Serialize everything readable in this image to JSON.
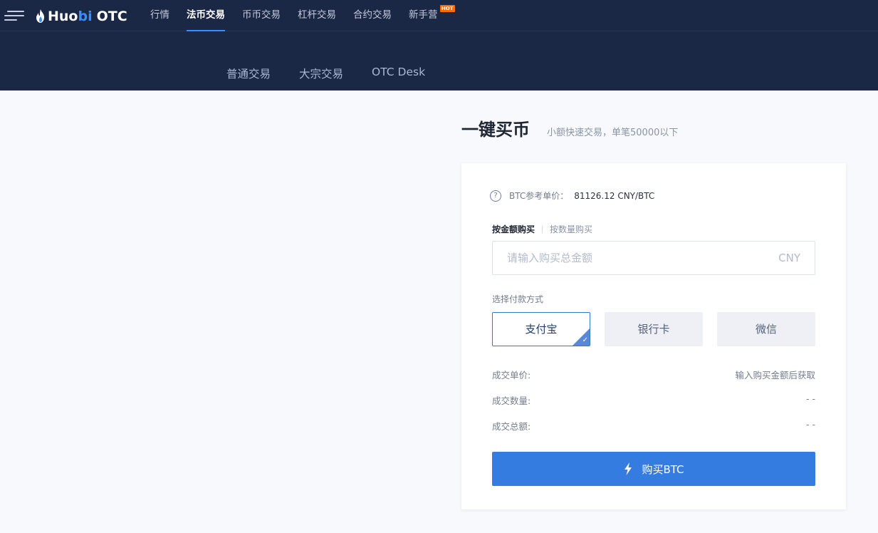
{
  "header": {
    "logo": {
      "brand_a": "Huo",
      "brand_b": "bi",
      "brand_c": "OTC"
    },
    "nav": [
      {
        "label": "行情",
        "active": false
      },
      {
        "label": "法币交易",
        "active": true
      },
      {
        "label": "币币交易",
        "active": false
      },
      {
        "label": "杠杆交易",
        "active": false
      },
      {
        "label": "合约交易",
        "active": false
      },
      {
        "label": "新手营",
        "active": false,
        "badge": "HOT"
      }
    ]
  },
  "subnav": [
    {
      "label": "普通交易"
    },
    {
      "label": "大宗交易"
    },
    {
      "label": "OTC Desk"
    }
  ],
  "page": {
    "title": "一键买币",
    "subtitle": "小额快速交易，单笔50000以下"
  },
  "card": {
    "ref_label": "BTC参考单价：",
    "ref_value": "81126.12 CNY/BTC",
    "modes": [
      {
        "label": "按金额购买",
        "active": true
      },
      {
        "label": "按数量购买",
        "active": false
      }
    ],
    "amount_input": {
      "placeholder": "请输入购买总金额",
      "value": "",
      "unit": "CNY"
    },
    "pay_label": "选择付款方式",
    "pay_methods": [
      {
        "label": "支付宝",
        "selected": true
      },
      {
        "label": "银行卡",
        "selected": false
      },
      {
        "label": "微信",
        "selected": false
      }
    ],
    "info": {
      "price_label": "成交单价:",
      "price_value": "输入购买金额后获取",
      "qty_label": "成交数量:",
      "qty_value": "- -",
      "total_label": "成交总额:",
      "total_value": "- -"
    },
    "buy_button": "购买BTC"
  },
  "colors": {
    "header_bg": "#1b2845",
    "accent": "#357ce1",
    "hot_badge": "#ff6a00"
  }
}
